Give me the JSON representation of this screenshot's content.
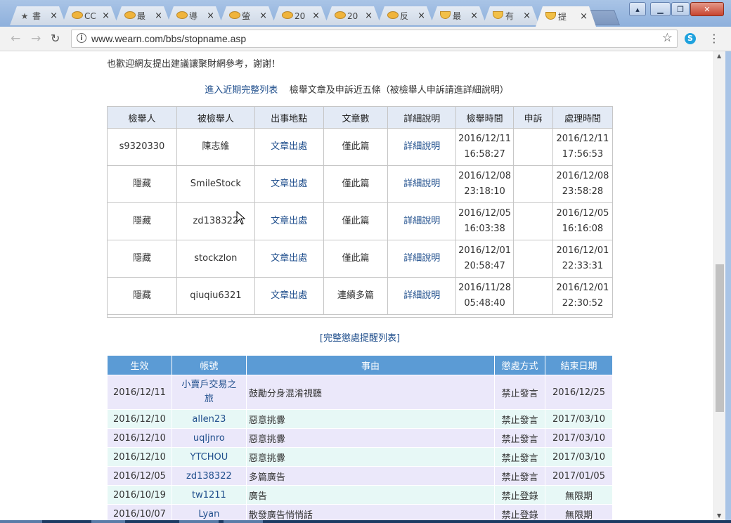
{
  "tabs": [
    {
      "icon": "star-icon",
      "label": "書",
      "active": false
    },
    {
      "icon": "coin-icon",
      "label": "CC",
      "active": false
    },
    {
      "icon": "coin-icon",
      "label": "最",
      "active": false
    },
    {
      "icon": "coin-icon",
      "label": "導",
      "active": false
    },
    {
      "icon": "coin-icon",
      "label": "螢",
      "active": false
    },
    {
      "icon": "coin-icon",
      "label": "20",
      "active": false
    },
    {
      "icon": "coin-icon",
      "label": "20",
      "active": false
    },
    {
      "icon": "coin-icon",
      "label": "反",
      "active": false
    },
    {
      "icon": "smile-icon",
      "label": "最",
      "active": false
    },
    {
      "icon": "smile-icon",
      "label": "有",
      "active": false
    },
    {
      "icon": "smile-icon",
      "label": "提",
      "active": true
    }
  ],
  "toolbar": {
    "url": "www.wearn.com/bbs/stopname.asp"
  },
  "page": {
    "note": "也歡迎網友提出建議讓聚財網參考，謝謝！",
    "recent_link": "進入近期完整列表",
    "recent_desc": "檢舉文章及申訴近五條（被檢舉人申訴請進詳細說明）",
    "report_headers": [
      "檢舉人",
      "被檢舉人",
      "出事地點",
      "文章數",
      "詳細說明",
      "檢舉時間",
      "申訴",
      "處理時間"
    ],
    "reports": [
      {
        "reporter": "s9320330",
        "reported": "陳志維",
        "location": "文章出處",
        "count": "僅此篇",
        "detail": "詳細說明",
        "report_date": "2016/12/11",
        "report_time": "16:58:27",
        "appeal": "",
        "handled_date": "2016/12/11",
        "handled_time": "17:56:53"
      },
      {
        "reporter": "隱藏",
        "reported": "SmileStock",
        "location": "文章出處",
        "count": "僅此篇",
        "detail": "詳細說明",
        "report_date": "2016/12/08",
        "report_time": "23:18:10",
        "appeal": "",
        "handled_date": "2016/12/08",
        "handled_time": "23:58:28"
      },
      {
        "reporter": "隱藏",
        "reported": "zd138322",
        "location": "文章出處",
        "count": "僅此篇",
        "detail": "詳細說明",
        "report_date": "2016/12/05",
        "report_time": "16:03:38",
        "appeal": "",
        "handled_date": "2016/12/05",
        "handled_time": "16:16:08"
      },
      {
        "reporter": "隱藏",
        "reported": "stockzlon",
        "location": "文章出處",
        "count": "僅此篇",
        "detail": "詳細說明",
        "report_date": "2016/12/01",
        "report_time": "20:58:47",
        "appeal": "",
        "handled_date": "2016/12/01",
        "handled_time": "22:33:31"
      },
      {
        "reporter": "隱藏",
        "reported": "qiuqiu6321",
        "location": "文章出處",
        "count": "連續多篇",
        "detail": "詳細說明",
        "report_date": "2016/11/28",
        "report_time": "05:48:40",
        "appeal": "",
        "handled_date": "2016/12/01",
        "handled_time": "22:30:52"
      }
    ],
    "full_list_link": "[完整懲處提醒列表]",
    "penalty_headers": [
      "生效",
      "帳號",
      "事由",
      "懲處方式",
      "結束日期"
    ],
    "penalties": [
      {
        "date": "2016/12/11",
        "account_line1": "小賣戶交易之",
        "account_line2": "旅",
        "reason": "鼓勵分身混淆視聽",
        "method": "禁止發言",
        "end": "2016/12/25"
      },
      {
        "date": "2016/12/10",
        "account": "allen23",
        "reason": "惡意挑釁",
        "method": "禁止發言",
        "end": "2017/03/10"
      },
      {
        "date": "2016/12/10",
        "account": "uqljnro",
        "reason": "惡意挑釁",
        "method": "禁止發言",
        "end": "2017/03/10"
      },
      {
        "date": "2016/12/10",
        "account": "YTCHOU",
        "reason": "惡意挑釁",
        "method": "禁止發言",
        "end": "2017/03/10"
      },
      {
        "date": "2016/12/05",
        "account": "zd138322",
        "reason": "多篇廣告",
        "method": "禁止發言",
        "end": "2017/01/05"
      },
      {
        "date": "2016/10/19",
        "account": "tw1211",
        "reason": "廣告",
        "method": "禁止登錄",
        "end": "無限期"
      },
      {
        "date": "2016/10/07",
        "account": "Lyan",
        "reason": "散發廣告悄悄話",
        "method": "禁止登錄",
        "end": "無限期"
      }
    ]
  }
}
